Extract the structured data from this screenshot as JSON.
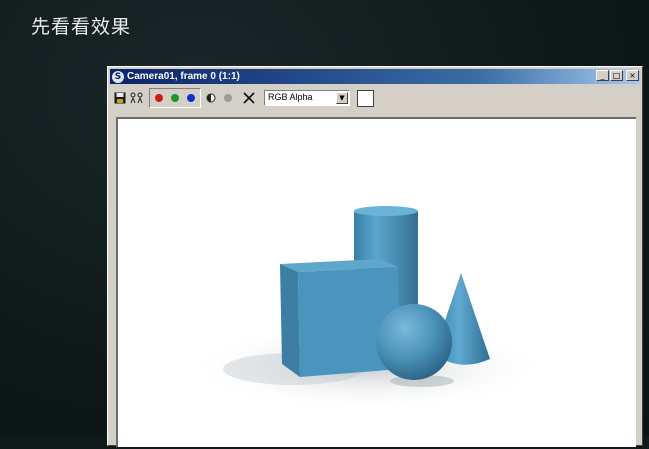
{
  "heading": "先看看效果",
  "window": {
    "title": "Camera01, frame 0 (1:1)",
    "app_icon": "3ds-max-icon",
    "buttons": {
      "minimize": "_",
      "maximize": "□",
      "close": "×"
    }
  },
  "toolbar": {
    "channel_select": {
      "value": "RGB Alpha"
    },
    "colors": {
      "red": "#d01818",
      "green": "#1a9a2a",
      "blue": "#1030c8"
    },
    "swatch_color": "#ffffff"
  },
  "scene": {
    "object_color": "#4f9bc2",
    "objects": [
      "box",
      "cylinder",
      "sphere",
      "cone"
    ]
  }
}
